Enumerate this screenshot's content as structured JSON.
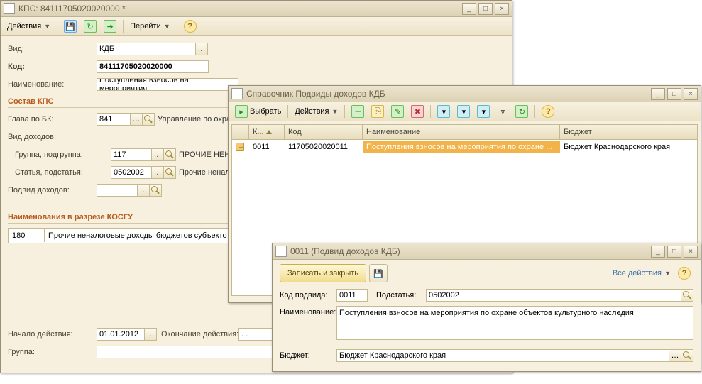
{
  "w1": {
    "title": "КПС: 84111705020020000 *",
    "toolbar": {
      "actions": "Действия",
      "goto": "Перейти"
    },
    "labels": {
      "vid": "Вид:",
      "kod": "Код:",
      "naim": "Наименование:",
      "sostav": "Состав КПС",
      "glava": "Глава по БК:",
      "vid_doh": "Вид доходов:",
      "grp": "Группа, подгруппа:",
      "stat": "Статья, подстатья:",
      "pod": "Подвид доходов:",
      "kosgu_sect": "Наименования в разрезе КОСГУ",
      "nach": "Начало действия:",
      "okon": "Окончание действия:",
      "gruppa": "Группа:"
    },
    "vals": {
      "vid": "КДБ",
      "kod": "84111705020020000",
      "naim": "Поступления взносов на мероприятия",
      "glava": "841",
      "glava_desc": "Управление по охране",
      "grp": "117",
      "grp_desc": "ПРОЧИЕ НЕНАЛО",
      "stat": "0502002",
      "stat_desc": "Прочие неналоговы",
      "pod": "",
      "kosgu_code": "180",
      "kosgu_name": "Прочие неналоговые доходы бюджетов субъекто",
      "nach": "01.01.2012",
      "okon": "  .  .    ",
      "gruppa": ""
    }
  },
  "w2": {
    "title": "Справочник Подвиды доходов КДБ",
    "toolbar": {
      "select": "Выбрать",
      "actions": "Действия"
    },
    "cols": {
      "c1": "К...",
      "c2": "Код",
      "c3": "Наименование",
      "c4": "Бюджет"
    },
    "row": {
      "c1": "0011",
      "c2": "11705020020011",
      "c3": "Поступления взносов на мероприятия по охране ...",
      "c4": "Бюджет Краснодарского края"
    }
  },
  "w3": {
    "title": "0011 (Подвид доходов КДБ)",
    "save": "Записать и закрыть",
    "all_actions": "Все действия",
    "labels": {
      "kod": "Код подвида:",
      "sub": "Подстатья:",
      "naim": "Наименование:",
      "budget": "Бюджет:"
    },
    "vals": {
      "kod": "0011",
      "sub": "0502002",
      "naim": "Поступления взносов на мероприятия по охране объектов культурного наследия",
      "budget": "Бюджет Краснодарского края"
    }
  }
}
